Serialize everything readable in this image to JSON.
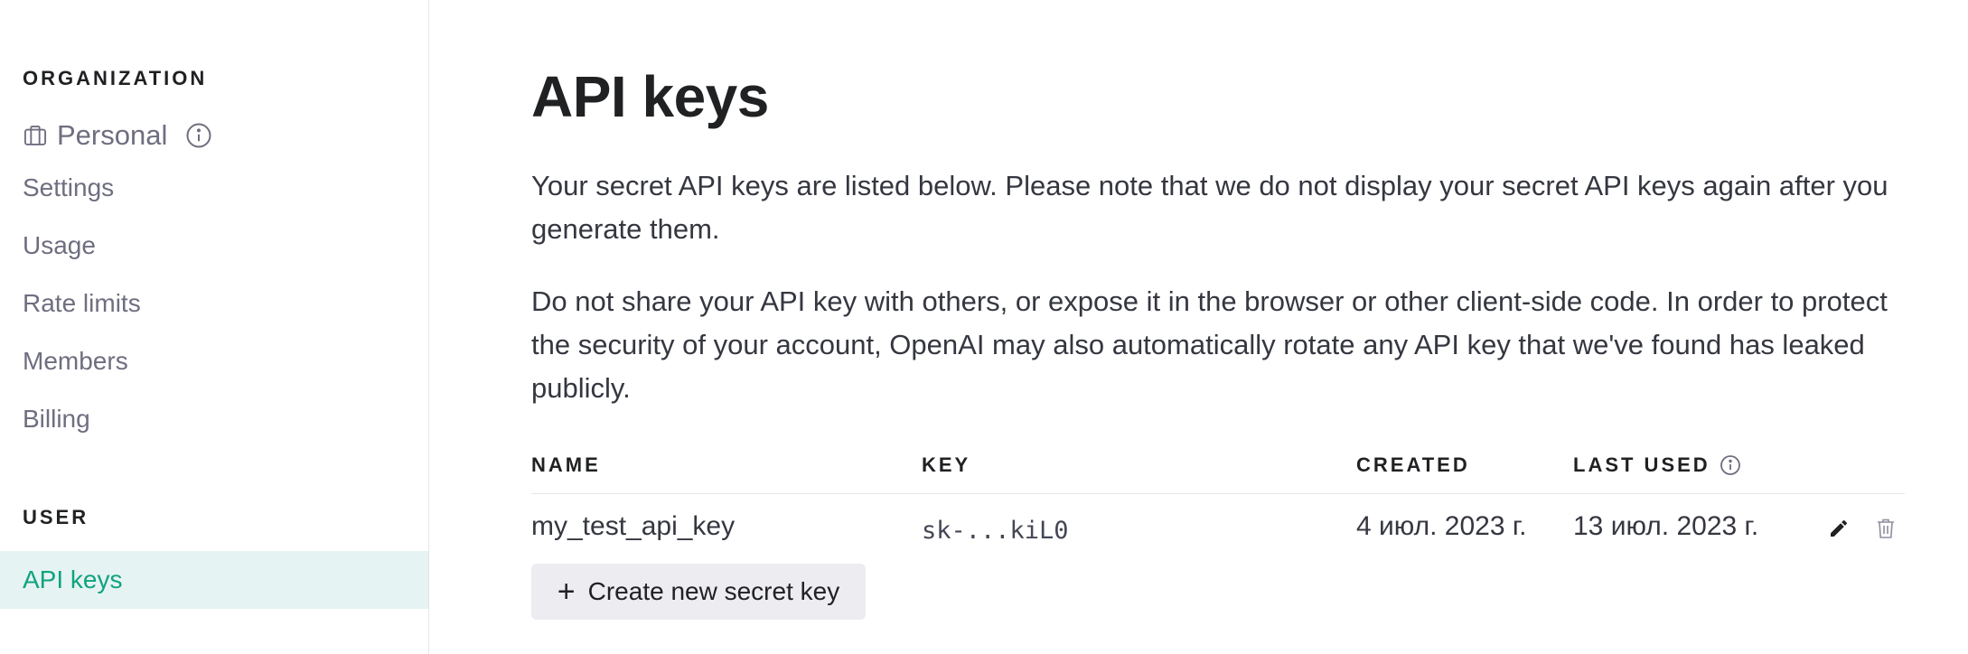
{
  "sidebar": {
    "organization_heading": "ORGANIZATION",
    "org_name": "Personal",
    "org_icon": "briefcase-icon",
    "org_info_icon": "info-icon",
    "items": [
      {
        "label": "Settings"
      },
      {
        "label": "Usage"
      },
      {
        "label": "Rate limits"
      },
      {
        "label": "Members"
      },
      {
        "label": "Billing"
      }
    ],
    "user_heading": "USER",
    "active_item": "API keys",
    "active_color": "#10a37f",
    "active_bg": "#e6f3f3"
  },
  "main": {
    "title": "API keys",
    "paragraph1": "Your secret API keys are listed below. Please note that we do not display your secret API keys again after you generate them.",
    "paragraph2": "Do not share your API key with others, or expose it in the browser or other client-side code. In order to protect the security of your account, OpenAI may also automatically rotate any API key that we've found has leaked publicly.",
    "table": {
      "headers": {
        "name": "NAME",
        "key": "KEY",
        "created": "CREATED",
        "last_used": "LAST USED"
      },
      "rows": [
        {
          "name": "my_test_api_key",
          "key": "sk-...kiL0",
          "created": "4 июл. 2023 г.",
          "last_used": "13 июл. 2023 г.",
          "actions": [
            "pencil-icon",
            "trash-icon"
          ]
        }
      ]
    },
    "create_button": {
      "icon": "plus-icon",
      "label": "Create new secret key"
    }
  }
}
